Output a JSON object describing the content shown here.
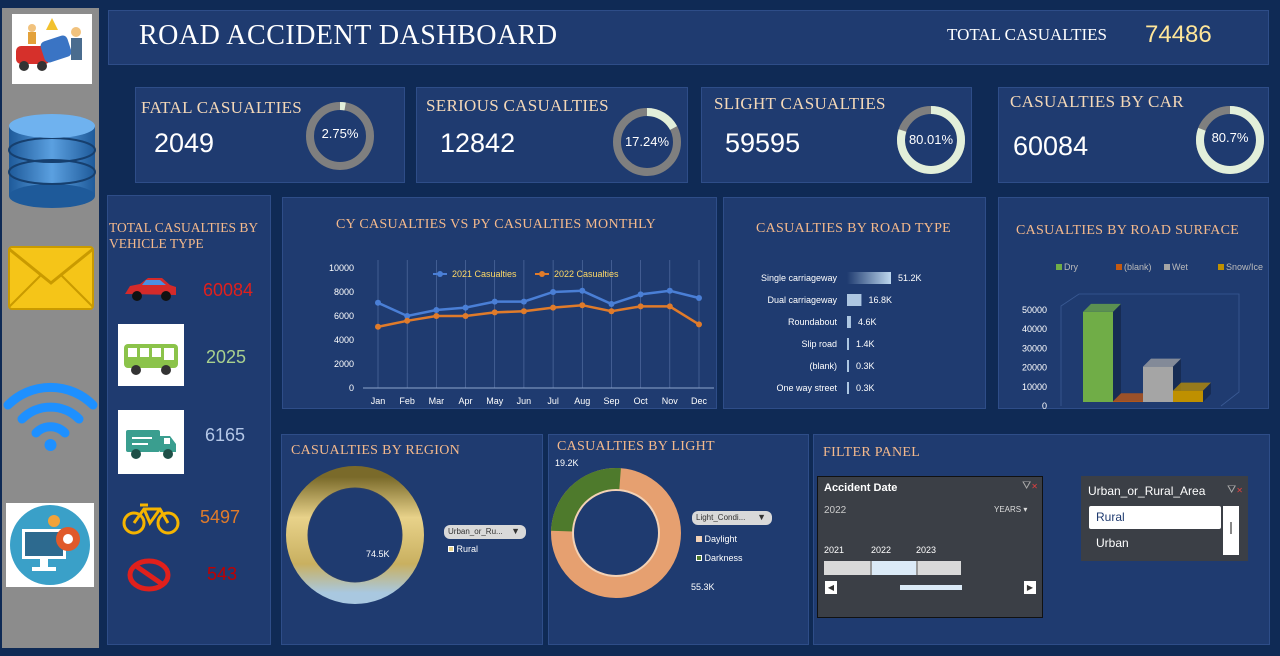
{
  "header": {
    "title": "ROAD ACCIDENT DASHBOARD",
    "total_label": "TOTAL CASUALTIES",
    "total_value": "74486"
  },
  "sidebar": {
    "icons": [
      "accident-image-icon",
      "database-icon",
      "mail-icon",
      "wifi-icon",
      "settings-computer-icon"
    ]
  },
  "kpis": [
    {
      "label": "FATAL CASUALTIES",
      "value": "2049",
      "pct": "2.75%",
      "fraction": 0.0275
    },
    {
      "label": "SERIOUS CASUALTIES",
      "value": "12842",
      "pct": "17.24%",
      "fraction": 0.1724
    },
    {
      "label": "SLIGHT CASUALTIES",
      "value": "59595",
      "pct": "80.01%",
      "fraction": 0.8001
    },
    {
      "label": "CASUALTIES BY CAR",
      "value": "60084",
      "pct": "80.7%",
      "fraction": 0.807
    }
  ],
  "vehicle": {
    "title_line1": "TOTAL CASUALTIES  BY",
    "title_line2": "VEHICLE TYPE",
    "items": [
      {
        "icon": "car-icon",
        "value": "60084",
        "color": "#e0201c"
      },
      {
        "icon": "bus-icon",
        "value": "2025",
        "color": "#a9d08e"
      },
      {
        "icon": "van-icon",
        "value": "6165",
        "color": "#b4c7e7"
      },
      {
        "icon": "bicycle-icon",
        "value": "5497",
        "color": "#e07b2a"
      },
      {
        "icon": "prohibited-icon",
        "value": "543",
        "color": "#c00000"
      }
    ]
  },
  "monthly": {
    "title": "CY CASUALTIES VS PY CASUALTIES MONTHLY"
  },
  "road_type": {
    "title": "CASUALTIES BY ROAD TYPE"
  },
  "road_surface": {
    "title": "CASUALTIES BY ROAD SURFACE"
  },
  "region": {
    "title": "CASUALTIES BY REGION",
    "filter_label": "Urban_or_Ru...",
    "legend": "Rural",
    "value_label": "74.5K"
  },
  "light": {
    "title": "CASUALTIES BY LIGHT",
    "filter_label": "Light_Condi...",
    "legend": [
      "Daylight",
      "Darkness"
    ],
    "labels": [
      "19.2K",
      "55.3K"
    ]
  },
  "filter": {
    "title": "FILTER PANEL",
    "timeline": {
      "header": "Accident Date",
      "selected": "2022",
      "period": "YEARS",
      "years": [
        "2021",
        "2022",
        "2023"
      ]
    },
    "slicer": {
      "header": "Urban_or_Rural_Area",
      "options": [
        "Rural",
        "Urban"
      ],
      "selected": "Rural"
    }
  },
  "chart_data": [
    {
      "type": "line",
      "title": "CY CASUALTIES VS PY CASUALTIES MONTHLY",
      "categories": [
        "Jan",
        "Feb",
        "Mar",
        "Apr",
        "May",
        "Jun",
        "Jul",
        "Aug",
        "Sep",
        "Oct",
        "Nov",
        "Dec"
      ],
      "series": [
        {
          "name": "2021 Casualties",
          "color": "#4a7fd6",
          "values": [
            7100,
            6000,
            6500,
            6700,
            7200,
            7200,
            8000,
            8100,
            7000,
            7800,
            8100,
            7500
          ]
        },
        {
          "name": "2022 Casualties",
          "color": "#e07b2a",
          "values": [
            5100,
            5600,
            6000,
            6000,
            6300,
            6400,
            6700,
            6900,
            6400,
            6800,
            6800,
            5300
          ]
        }
      ],
      "yticks": [
        "0",
        "2000",
        "4000",
        "6000",
        "8000",
        "10000"
      ],
      "ylim": [
        0,
        10000
      ]
    },
    {
      "type": "bar",
      "title": "CASUALTIES BY ROAD TYPE",
      "categories": [
        "Single carriageway",
        "Dual carriageway",
        "Roundabout",
        "Slip road",
        "(blank)",
        "One way street"
      ],
      "values": [
        51200,
        16800,
        4600,
        1400,
        300,
        300
      ],
      "labels": [
        "51.2K",
        "16.8K",
        "4.6K",
        "1.4K",
        "0.3K",
        "0.3K"
      ]
    },
    {
      "type": "bar",
      "title": "CASUALTIES BY ROAD SURFACE",
      "categories": [
        "Dry",
        "(blank)",
        "Wet",
        "Snow/Ice"
      ],
      "colors": [
        "#70ad47",
        "#c55a11",
        "#a5a5a5",
        "#bf9000"
      ],
      "values": [
        49000,
        2500,
        20500,
        8000
      ],
      "yticks": [
        "0",
        "10000",
        "20000",
        "30000",
        "40000",
        "50000"
      ],
      "ylim": [
        0,
        50000
      ]
    }
  ]
}
